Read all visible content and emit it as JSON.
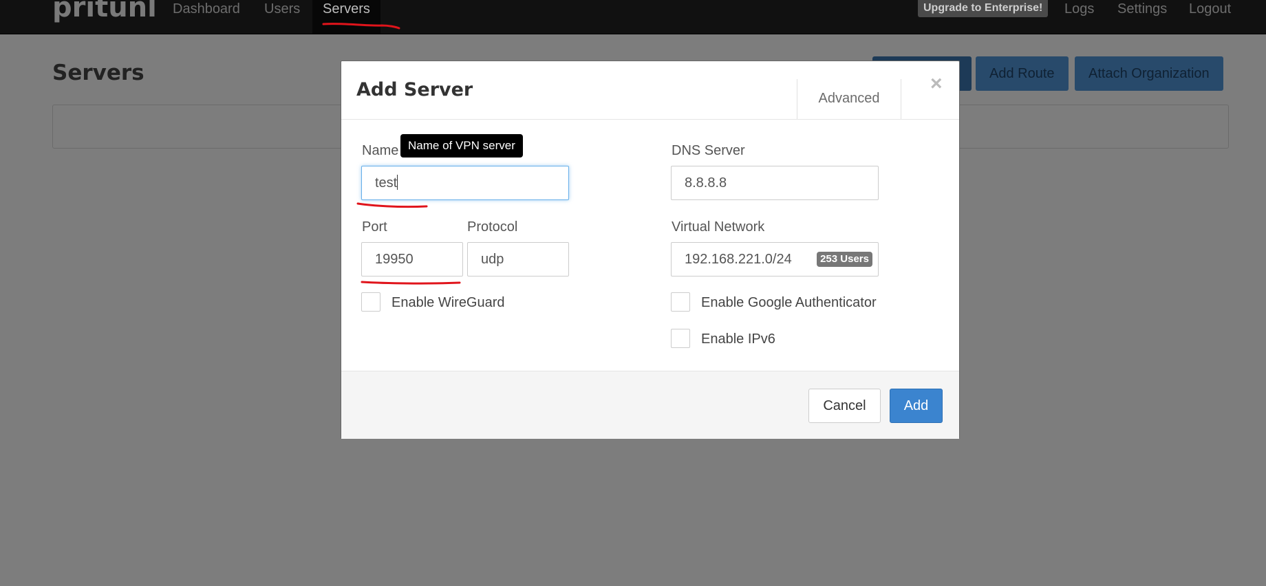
{
  "navbar": {
    "brand": "pritunl",
    "items": [
      {
        "label": "Dashboard"
      },
      {
        "label": "Users"
      },
      {
        "label": "Servers",
        "active": true
      }
    ],
    "upgrade_label": "Upgrade to Enterprise!",
    "right_items": [
      {
        "label": "Logs"
      },
      {
        "label": "Settings"
      },
      {
        "label": "Logout"
      }
    ]
  },
  "page": {
    "title": "Servers",
    "buttons": {
      "add_route": "Add Route",
      "attach_org": "Attach Organization"
    }
  },
  "modal": {
    "title": "Add Server",
    "advanced_label": "Advanced",
    "close_glyph": "×",
    "name": {
      "label": "Name",
      "value": "test",
      "tooltip": "Name of VPN server"
    },
    "dns": {
      "label": "DNS Server",
      "value": "8.8.8.8"
    },
    "port": {
      "label": "Port",
      "value": "19950"
    },
    "protocol": {
      "label": "Protocol",
      "value": "udp"
    },
    "network": {
      "label": "Virtual Network",
      "value": "192.168.221.0/24",
      "badge": "253 Users"
    },
    "checkboxes": {
      "wireguard": "Enable WireGuard",
      "google_auth": "Enable Google Authenticator",
      "ipv6": "Enable IPv6"
    },
    "cancel_label": "Cancel",
    "add_label": "Add"
  },
  "colors": {
    "accent": "#3b84cf",
    "annotation": "#e0141b"
  },
  "icons": {
    "close": "close-icon"
  }
}
